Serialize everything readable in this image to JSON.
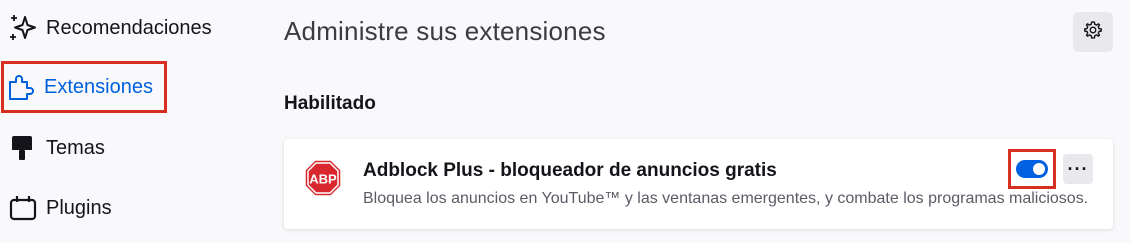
{
  "sidebar": {
    "items": [
      {
        "label": "Recomendaciones",
        "icon": "sparkles-icon"
      },
      {
        "label": "Extensiones",
        "icon": "puzzle-icon",
        "selected": true
      },
      {
        "label": "Temas",
        "icon": "paintbrush-icon"
      },
      {
        "label": "Plugins",
        "icon": "plugin-icon"
      }
    ]
  },
  "main": {
    "title": "Administre sus extensiones",
    "settings_icon": "gear-icon",
    "section_heading": "Habilitado",
    "addon": {
      "icon": "abp-icon",
      "icon_text": "ABP",
      "name": "Adblock Plus - bloqueador de anuncios gratis",
      "description": "Bloquea los anuncios en YouTube™ y las ventanas emergentes, y combate los programas maliciosos.",
      "enabled": true,
      "more_label": "···"
    }
  },
  "colors": {
    "accent": "#0061e0",
    "highlight": "#d7301f",
    "abp_red": "#d8272d"
  }
}
